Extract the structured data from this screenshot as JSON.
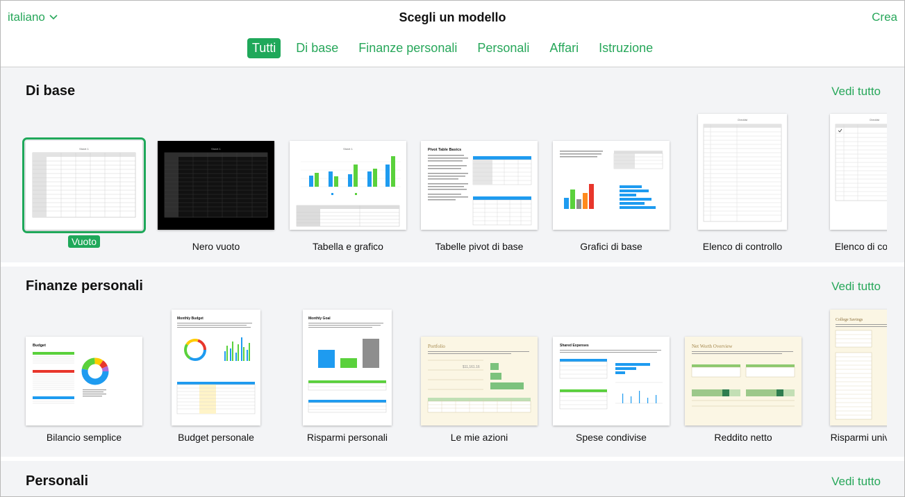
{
  "header": {
    "language": "italiano",
    "title": "Scegli un modello",
    "create": "Crea",
    "tabs": [
      "Tutti",
      "Di base",
      "Finanze personali",
      "Personali",
      "Affari",
      "Istruzione"
    ],
    "active_tab": "Tutti"
  },
  "sections": [
    {
      "title": "Di base",
      "see_all": "Vedi tutto",
      "templates": [
        {
          "label": "Vuoto",
          "selected": true
        },
        {
          "label": "Nero vuoto"
        },
        {
          "label": "Tabella e grafico"
        },
        {
          "label": "Tabelle pivot di base"
        },
        {
          "label": "Grafici di base"
        },
        {
          "label": "Elenco di controllo"
        },
        {
          "label": "Elenco di controllo"
        }
      ]
    },
    {
      "title": "Finanze personali",
      "see_all": "Vedi tutto",
      "templates": [
        {
          "label": "Bilancio semplice"
        },
        {
          "label": "Budget personale"
        },
        {
          "label": "Risparmi personali"
        },
        {
          "label": "Le mie azioni"
        },
        {
          "label": "Spese condivise"
        },
        {
          "label": "Reddito netto"
        },
        {
          "label": "Risparmi universitari"
        }
      ]
    },
    {
      "title": "Personali",
      "see_all": "Vedi tutto"
    }
  ],
  "thumb_text": {
    "sheet1": "Sheet 1",
    "pivot": "Pivot Table Basics",
    "budget": "Budget",
    "monthly_budget": "Monthly Budget",
    "monthly_goal": "Monthly Goal",
    "portfolio": "Portfolio",
    "portfolio_value": "$11,161.16",
    "shared_expenses": "Shared Expenses",
    "net_worth": "Net Worth Overview",
    "college": "College Savings",
    "checklist": "Checklist"
  },
  "colors": {
    "accent": "#1fa85a",
    "bar_blue": "#1e9bf0",
    "bar_green": "#5ad13c",
    "bar_gray": "#8e8e8e",
    "bar_orange": "#ff8a1d",
    "bar_red": "#e8362b"
  }
}
